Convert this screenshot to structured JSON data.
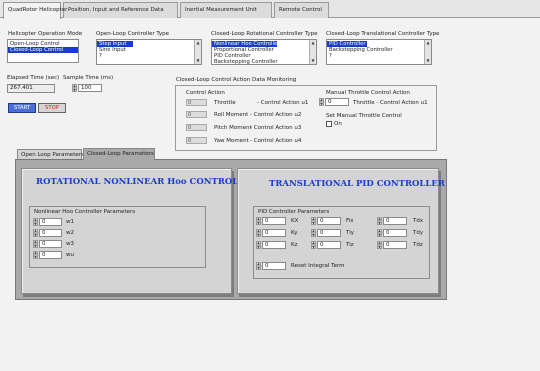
{
  "tabs": [
    "QuadRotor Helicopter",
    "Position, Input and Reference Data",
    "Inertial Measurement Unit",
    "Remote Control"
  ],
  "operation_mode": {
    "label": "Helicopter Operation Mode",
    "items": [
      "Open-Loop Control",
      "Closed-Loop Control"
    ],
    "selected": 1
  },
  "open_loop_type": {
    "label": "Open-Loop Controller Type",
    "items": [
      "Step Input",
      "Sine Input",
      "?"
    ],
    "selected": 0
  },
  "rot_type": {
    "label": "Closed-Loop Rotational Controller Type",
    "items": [
      "Nonlinear Hoo Controller",
      "Proportional Controller",
      "PID Controller",
      "Backstepping Controller"
    ],
    "selected": 0
  },
  "trans_type": {
    "label": "Closed-Loop Translational Controller Type",
    "items": [
      "PID Controller",
      "Backstepping Controller",
      "?"
    ],
    "selected": 0
  },
  "elapsed": {
    "label": "Elapsed Time (sec)",
    "value": "267.401"
  },
  "sample": {
    "label": "Sample Time (ms)",
    "value": "100"
  },
  "buttons": {
    "start": "START",
    "stop": "STOP"
  },
  "monitor": {
    "title": "Closed-Loop Control Action Data Monitoring",
    "control_action": "Control Action",
    "rows": [
      {
        "value": "0",
        "name": "Throttle",
        "desc": "- Control Action u1"
      },
      {
        "value": "0",
        "name": "Roll Moment",
        "desc": "- Control Action u2"
      },
      {
        "value": "0",
        "name": "Pitch Moment",
        "desc": "- Control Action u3"
      },
      {
        "value": "0",
        "name": "Yaw Moment",
        "desc": "- Control Action u4"
      }
    ],
    "manual_title": "Manual Throttle Control Action",
    "manual_value": "0",
    "manual_desc": "Throttle - Control Action u1",
    "set_manual": "Set Manual Throttle Control",
    "on": "On"
  },
  "subtabs": [
    "Open Loop Parameters",
    "Closed-Loop Parameters"
  ],
  "rot": {
    "title": "ROTATIONAL NONLINEAR Hoo CONTROLLER",
    "params_label": "Nonlinear Hoo Controller Parameters",
    "params": [
      {
        "value": "0",
        "name": "w1"
      },
      {
        "value": "0",
        "name": "w2"
      },
      {
        "value": "0",
        "name": "w3"
      },
      {
        "value": "0",
        "name": "wu"
      }
    ]
  },
  "trans": {
    "title": "TRANSLATIONAL PID CONTROLLER",
    "params_label": "PID Controller Parameters",
    "grid": [
      [
        {
          "value": "0",
          "name": "KX"
        },
        {
          "value": "0",
          "name": "Fix"
        },
        {
          "value": "0",
          "name": "Tdx"
        }
      ],
      [
        {
          "value": "0",
          "name": "Ky"
        },
        {
          "value": "0",
          "name": "Tiy"
        },
        {
          "value": "0",
          "name": "Tdy"
        }
      ],
      [
        {
          "value": "0",
          "name": "Kz"
        },
        {
          "value": "0",
          "name": "Tiz"
        },
        {
          "value": "0",
          "name": "Tdz"
        }
      ]
    ],
    "reset": {
      "value": "0",
      "name": "Reset Integral Term"
    }
  },
  "colors": {
    "selection": "#1a3ccc",
    "title_blue": "#1a3ccc",
    "start": "#4a6fd8",
    "stop": "#d02020"
  }
}
